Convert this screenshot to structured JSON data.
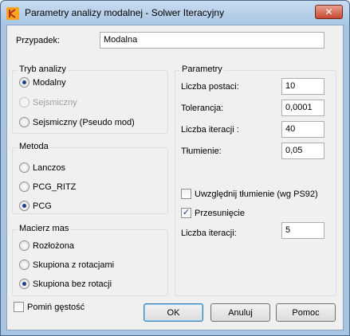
{
  "window": {
    "title": "Parametry analizy modalnej - Solwer Iteracyjny",
    "close_glyph": "✕"
  },
  "case": {
    "label": "Przypadek:",
    "value": "Modalna"
  },
  "analysis_mode": {
    "title": "Tryb analizy",
    "options": [
      {
        "label": "Modalny",
        "checked": true,
        "disabled": false
      },
      {
        "label": "Sejsmiczny",
        "checked": false,
        "disabled": true
      },
      {
        "label": "Sejsmiczny (Pseudo mod)",
        "checked": false,
        "disabled": false
      }
    ]
  },
  "method": {
    "title": "Metoda",
    "options": [
      {
        "label": "Lanczos",
        "checked": false
      },
      {
        "label": "PCG_RITZ",
        "checked": false
      },
      {
        "label": "PCG",
        "checked": true
      }
    ]
  },
  "mass_matrix": {
    "title": "Macierz mas",
    "options": [
      {
        "label": "Rozłożona",
        "checked": false
      },
      {
        "label": "Skupiona z rotacjami",
        "checked": false
      },
      {
        "label": "Skupiona bez rotacji",
        "checked": true
      }
    ]
  },
  "parameters": {
    "title": "Parametry",
    "fields": [
      {
        "label": "Liczba postaci:",
        "value": "10"
      },
      {
        "label": "Tolerancja:",
        "value": "0,0001"
      },
      {
        "label": "Liczba iteracji :",
        "value": "40"
      },
      {
        "label": "Tłumienie:",
        "value": "0,05"
      }
    ],
    "include_damping": {
      "label": "Uwzględnij tłumienie (wg PS92)",
      "checked": false
    },
    "shift": {
      "label": "Przesunięcie",
      "checked": true
    },
    "shift_iterations": {
      "label": "Liczba iteracji:",
      "value": "5"
    }
  },
  "omit_density": {
    "label": "Pomiń gęstość",
    "checked": false
  },
  "buttons": {
    "ok": "OK",
    "cancel": "Anuluj",
    "help": "Pomoc"
  },
  "check_glyph": "✓"
}
